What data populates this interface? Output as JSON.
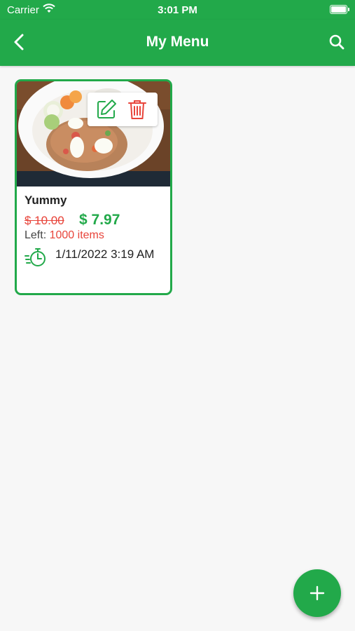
{
  "status_bar": {
    "carrier": "Carrier",
    "time": "3:01 PM"
  },
  "header": {
    "title": "My Menu",
    "back_icon": "chevron-left-icon",
    "search_icon": "search-icon"
  },
  "menu_items": [
    {
      "name": "Yummy",
      "original_price": "$ 10.00",
      "price": "$ 7.97",
      "left_label": "Left:",
      "left_value": "1000 items",
      "date": "1/11/2022 3:19 AM",
      "image": "food-photo",
      "actions": [
        "edit-icon",
        "trash-icon"
      ]
    }
  ],
  "fab": {
    "icon": "plus-icon"
  },
  "colors": {
    "primary": "#22a94a",
    "danger": "#e8443a",
    "background": "#f7f7f7"
  }
}
